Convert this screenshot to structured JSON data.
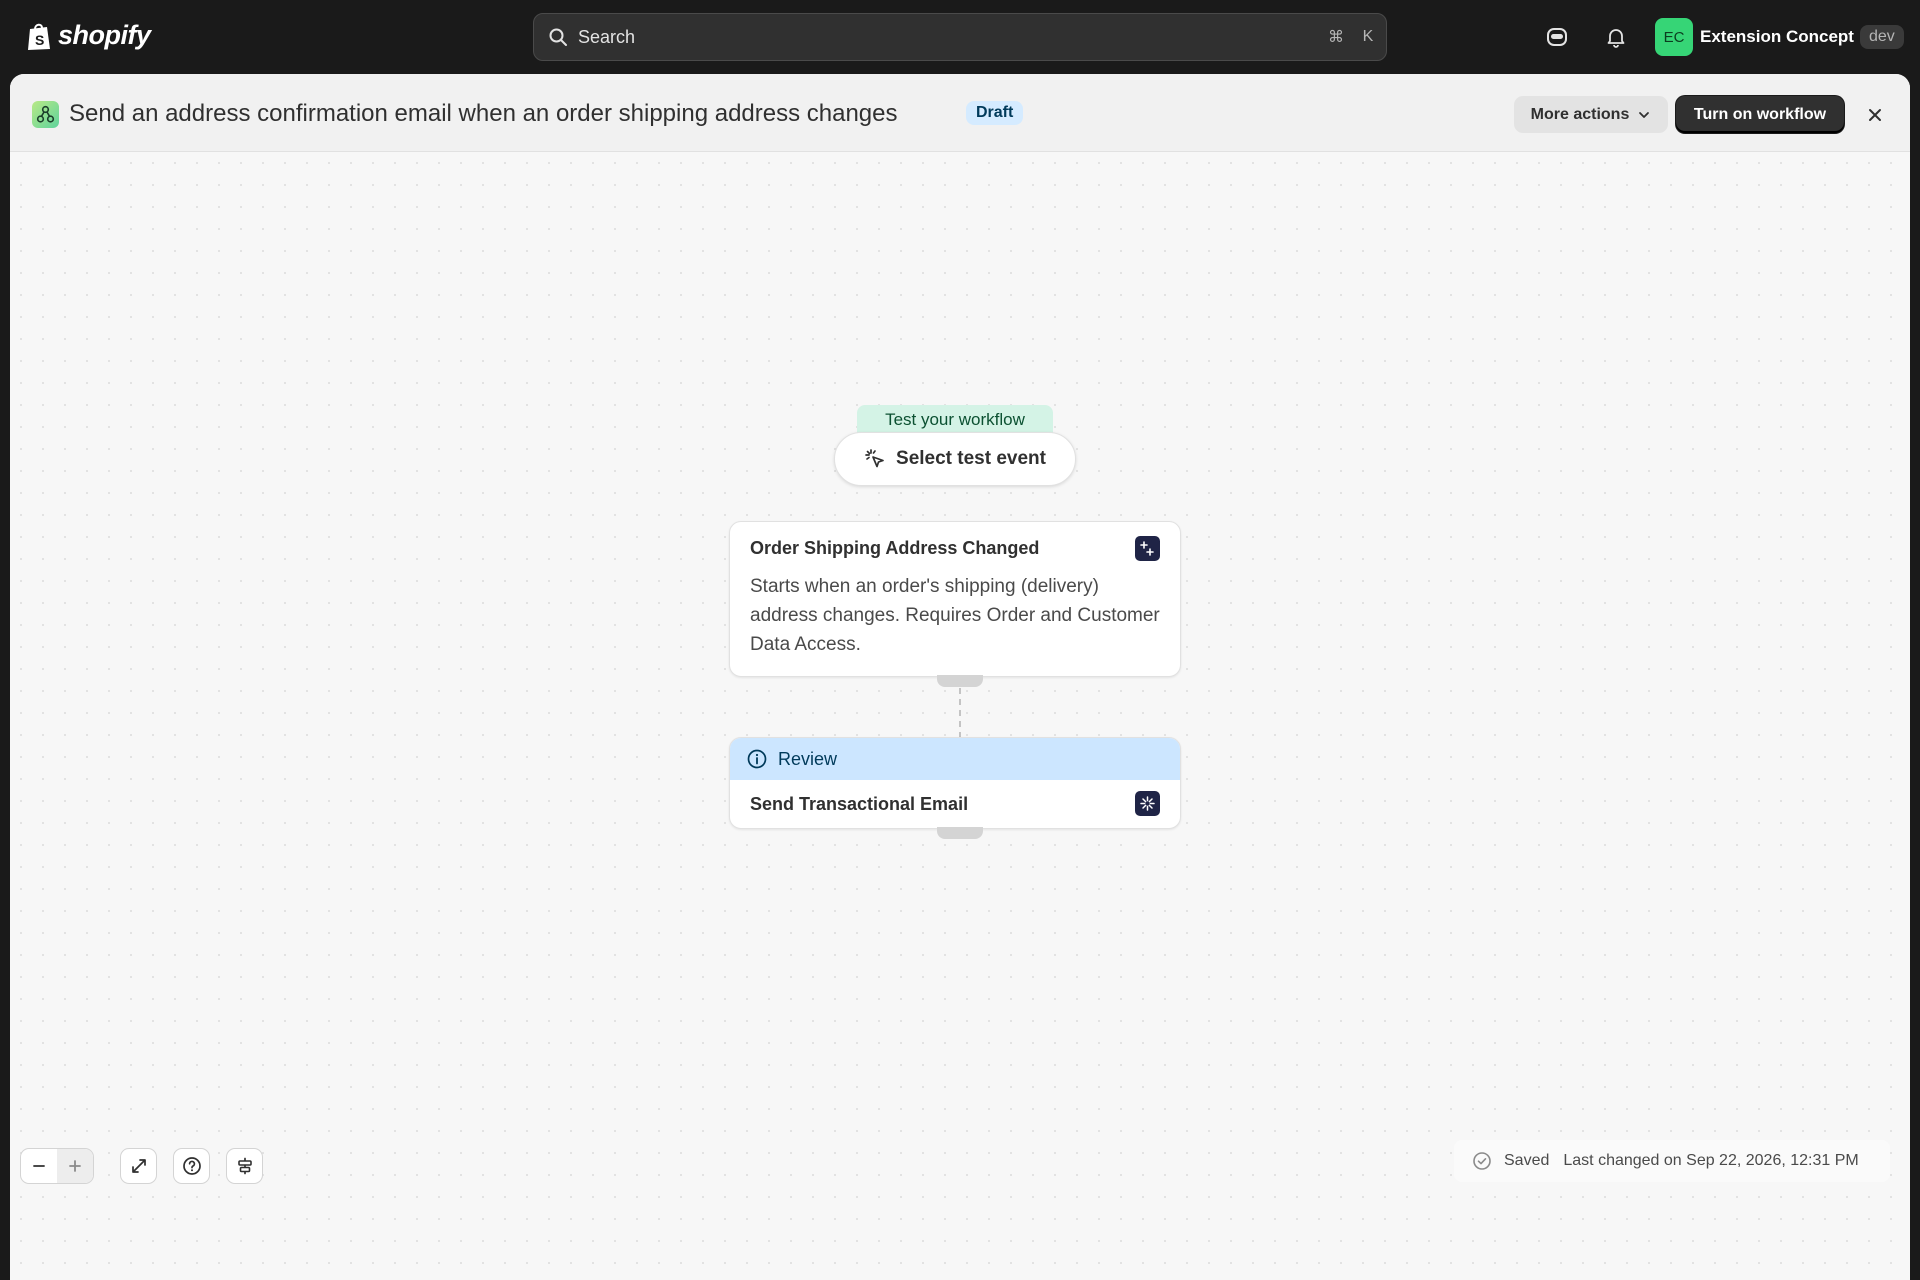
{
  "topbar": {
    "brand": "shopify",
    "search_placeholder": "Search",
    "shortcut_mod": "⌘",
    "shortcut_key": "K",
    "store": {
      "initials": "EC",
      "name": "Extension Concept",
      "badge": "dev"
    }
  },
  "header": {
    "title": "Send an address confirmation email when an order shipping address changes",
    "status": "Draft",
    "more_actions": "More actions",
    "primary_action": "Turn on workflow"
  },
  "canvas": {
    "test_label": "Test your workflow",
    "test_button": "Select test event",
    "trigger": {
      "title": "Order Shipping Address Changed",
      "description": "Starts when an order's shipping (delivery) address changes. Requires Order and Customer Data Access."
    },
    "action": {
      "status": "Review",
      "title": "Send Transactional Email"
    }
  },
  "footer": {
    "saved": "Saved",
    "last_changed": "Last changed on Sep 22, 2026, 12:31 PM"
  },
  "colors": {
    "accent_dark": "#303030",
    "avatar": "#36d576",
    "draft_badge": "#d5ebff",
    "review_bar": "#cce6ff",
    "test_label": "#d4f3e6"
  }
}
